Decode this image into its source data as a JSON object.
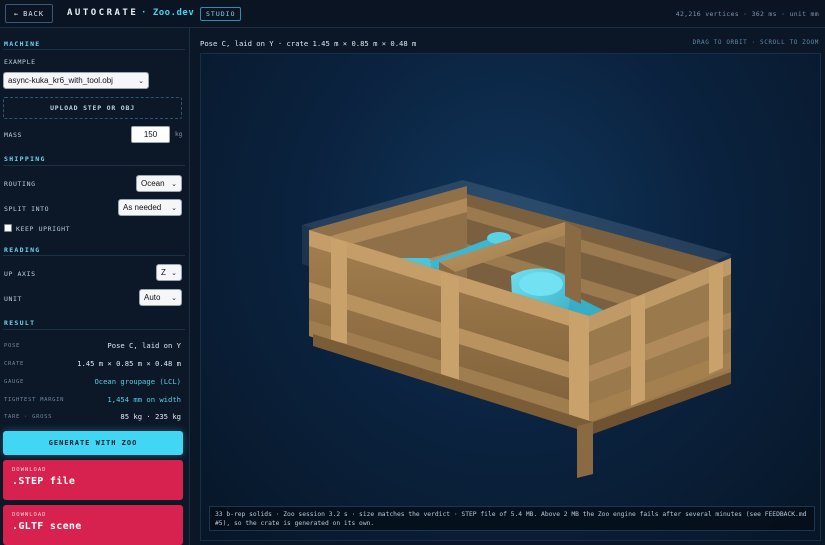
{
  "topbar": {
    "back_label": "BACK",
    "brand": "AUTOCRATE",
    "brand_sub": "· Zoo.dev",
    "studio": "STUDIO",
    "stats": "42,216 vertices · 362 ms · unit mm"
  },
  "machine": {
    "title": "MACHINE",
    "example_label": "EXAMPLE",
    "example_value": "async-kuka_kr6_with_tool.obj",
    "upload_label": "UPLOAD STEP OR OBJ",
    "mass_label": "MASS",
    "mass_value": "150",
    "mass_unit": "kg"
  },
  "shipping": {
    "title": "SHIPPING",
    "routing_label": "ROUTING",
    "routing_value": "Ocean",
    "split_label": "SPLIT INTO",
    "split_value": "As needed",
    "keep_upright_label": "KEEP UPRIGHT"
  },
  "reading": {
    "title": "READING",
    "up_axis_label": "UP AXIS",
    "up_axis_value": "Z",
    "unit_label": "UNIT",
    "unit_value": "Auto"
  },
  "result": {
    "title": "RESULT",
    "rows": [
      {
        "label": "POSE",
        "value": "Pose C, laid on Y"
      },
      {
        "label": "CRATE",
        "value": "1.45 m × 0.85 m × 0.48 m"
      },
      {
        "label": "GAUGE",
        "value": "Ocean groupage (LCL)"
      },
      {
        "label": "TIGHTEST MARGIN",
        "value": "1,454 mm on width"
      },
      {
        "label": "TARE · GROSS",
        "value": "85 kg · 235 kg"
      }
    ]
  },
  "actions": {
    "generate_label": "GENERATE WITH ZOO",
    "download_small": "DOWNLOAD",
    "step_label": ".STEP file",
    "gltf_label": ".GLTF scene"
  },
  "viewport": {
    "heading": "Pose C, laid on Y · crate 1.45 m × 0.85 m × 0.48 m",
    "hint": "DRAG TO ORBIT · SCROLL TO ZOOM",
    "caption": "33 b-rep solids · Zoo session 3.2 s · size matches the verdict · STEP file of 5.4 MB. Above 2 MB the Zoo engine fails after several minutes (see FEEDBACK.md #5), so the crate is generated on its own."
  },
  "colors": {
    "accent": "#41d6f3",
    "download": "#d7224f",
    "wood": "#b08a5a",
    "machine": "#4cc5dc"
  }
}
